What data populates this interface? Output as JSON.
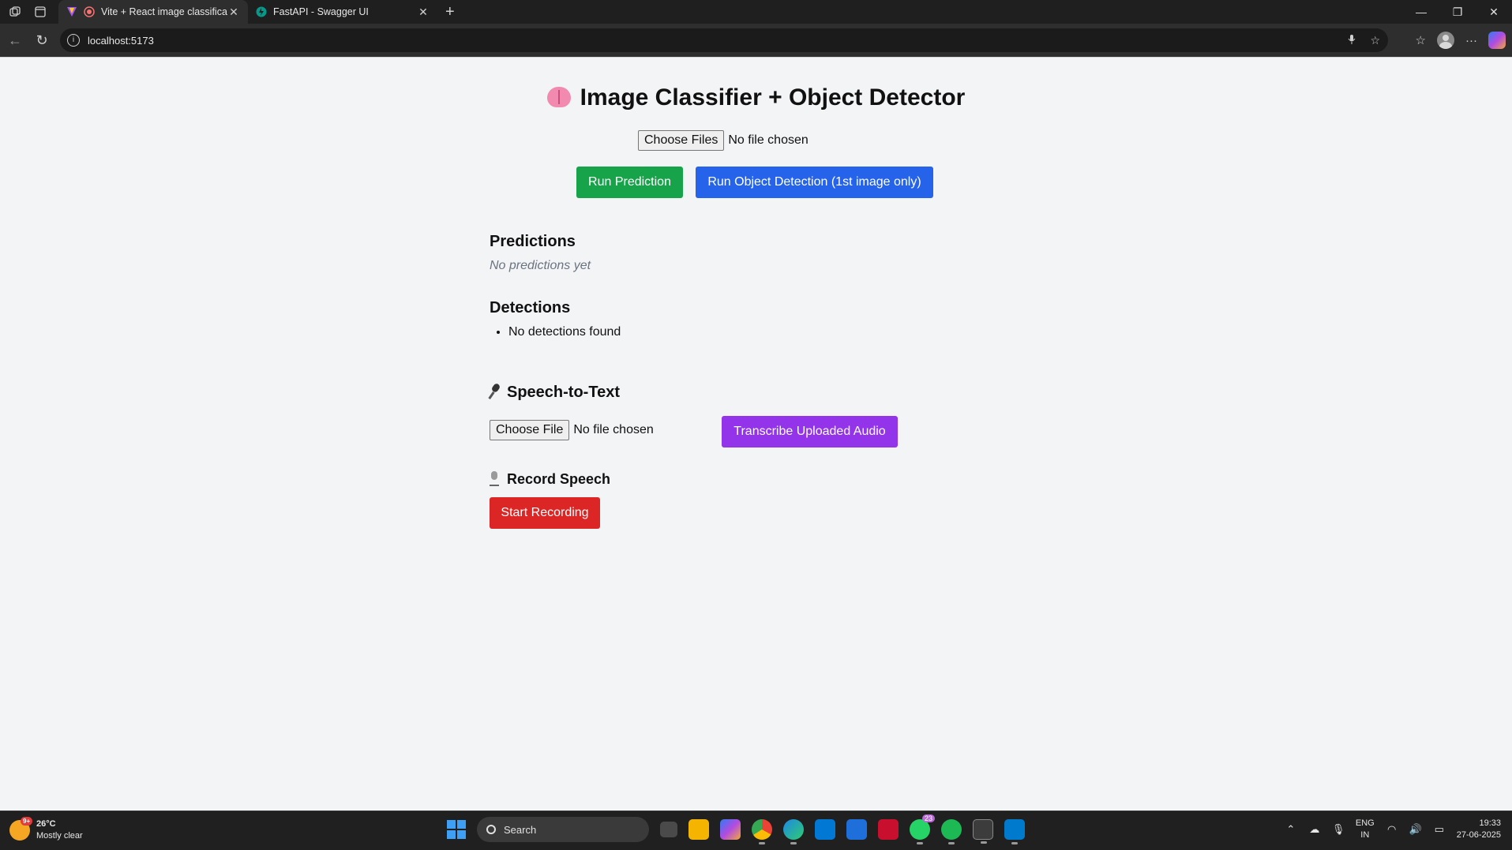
{
  "browser": {
    "tabs": [
      {
        "title": "Vite + React image classificat",
        "active": true
      },
      {
        "title": "FastAPI - Swagger UI",
        "active": false
      }
    ],
    "new_tab_symbol": "+",
    "address": "localhost:5173"
  },
  "page": {
    "title": "Image Classifier + Object Detector",
    "file_picker": {
      "button": "Choose Files",
      "status": "No file chosen"
    },
    "run_prediction": "Run Prediction",
    "run_detection": "Run Object Detection (1st image only)",
    "predictions": {
      "heading": "Predictions",
      "empty": "No predictions yet"
    },
    "detections": {
      "heading": "Detections",
      "items": [
        "No detections found"
      ]
    },
    "speech": {
      "heading": "Speech-to-Text",
      "file_button": "Choose File",
      "file_status": "No file chosen",
      "transcribe": "Transcribe Uploaded Audio",
      "record_heading": "Record Speech",
      "start_recording": "Start Recording"
    },
    "colors": {
      "green": "#16a34a",
      "blue": "#2563eb",
      "purple": "#9333ea",
      "red": "#dc2626"
    }
  },
  "taskbar": {
    "weather": {
      "temp": "26°C",
      "condition": "Mostly clear",
      "badge": "9+"
    },
    "search_label": "Search",
    "whatsapp_badge": "23",
    "language": {
      "lang": "ENG",
      "region": "IN"
    },
    "clock": {
      "time": "19:33",
      "date": "27-06-2025"
    }
  }
}
